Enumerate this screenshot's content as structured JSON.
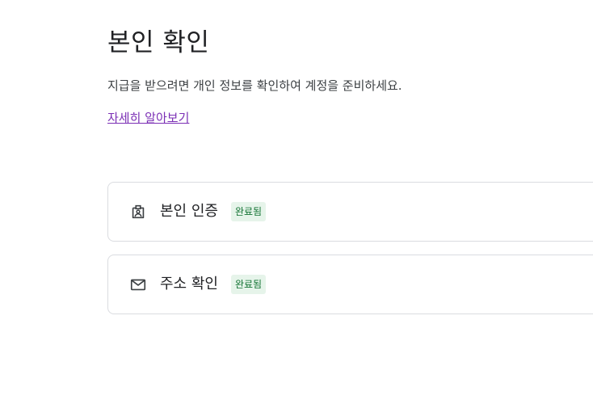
{
  "page": {
    "title": "본인 확인",
    "description": "지급을 받으려면 개인 정보를 확인하여 계정을 준비하세요.",
    "learn_more": "자세히 알아보기"
  },
  "cards": [
    {
      "label": "본인 인증",
      "status": "완료됨",
      "icon": "id-badge-icon"
    },
    {
      "label": "주소 확인",
      "status": "완료됨",
      "icon": "mail-icon"
    }
  ],
  "colors": {
    "link": "#7b2fb5",
    "badge_background": "#e6f4ea",
    "badge_text": "#137333",
    "card_border": "#dadce0"
  }
}
